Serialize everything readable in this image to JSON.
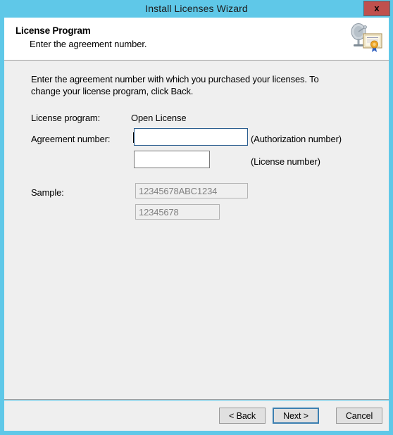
{
  "window": {
    "title": "Install Licenses Wizard",
    "close_label": "x",
    "accent_color": "#5fc8e8",
    "close_button_color": "#c0504d",
    "content_bg": "#efefef"
  },
  "header": {
    "title": "License Program",
    "subtitle": "Enter the agreement number.",
    "icon": "license-certificate-icon"
  },
  "content": {
    "intro": "Enter the agreement number with which you purchased your licenses. To change your license program, click Back.",
    "license_program": {
      "label": "License program:",
      "value": "Open License"
    },
    "agreement_number": {
      "label": "Agreement number:",
      "authorization": {
        "value": "",
        "placeholder": "",
        "note": "(Authorization number)",
        "focused": true
      },
      "license": {
        "value": "",
        "placeholder": "",
        "note": "(License number)",
        "focused": false
      }
    },
    "sample": {
      "label": "Sample:",
      "authorization_example": "12345678ABC1234",
      "license_example": "12345678"
    }
  },
  "footer": {
    "back_label": "< Back",
    "next_label": "Next >",
    "cancel_label": "Cancel"
  }
}
